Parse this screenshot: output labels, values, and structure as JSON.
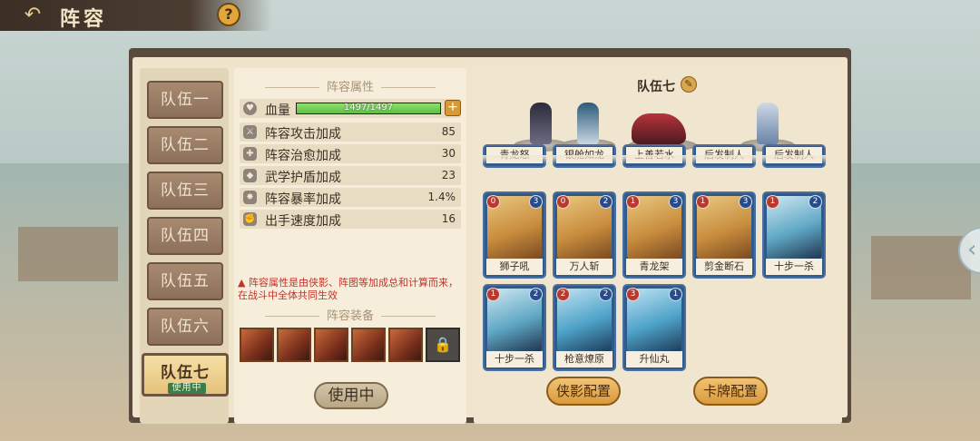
{
  "header": {
    "title": "阵容",
    "back_icon": "back-arrow-icon",
    "help_label": "?"
  },
  "side_arrow": "‹",
  "teams": [
    {
      "label": "队伍一"
    },
    {
      "label": "队伍二"
    },
    {
      "label": "队伍三"
    },
    {
      "label": "队伍四"
    },
    {
      "label": "队伍五"
    },
    {
      "label": "队伍六"
    },
    {
      "label": "队伍七",
      "badge": "使用中",
      "active": true
    }
  ],
  "attributes": {
    "section_title": "阵容属性",
    "hp": {
      "label": "血量",
      "text": "1497/1497",
      "fraction": 1.0
    },
    "hp_plus": "+",
    "rows": [
      {
        "label": "阵容攻击加成",
        "value": "85"
      },
      {
        "label": "阵容治愈加成",
        "value": "30"
      },
      {
        "label": "武学护盾加成",
        "value": "23"
      },
      {
        "label": "阵容暴率加成",
        "value": "1.4%"
      },
      {
        "label": "出手速度加成",
        "value": "16"
      }
    ],
    "note": "阵容属性是由侠影、阵图等加成总和计算而来，在战斗中全体共同生效"
  },
  "equipment": {
    "section_title": "阵容装备",
    "locked_icon": "lock-icon",
    "in_use_label": "使用中"
  },
  "lineup": {
    "team_name": "队伍七",
    "edit_icon": "quill-edit-icon",
    "top_row_cards": [
      "青龙怒",
      "银舱如龙",
      "上善若水",
      "后发制人",
      "后发制人"
    ],
    "cards": [
      {
        "name": "狮子吼",
        "cost": "0",
        "level": "3"
      },
      {
        "name": "万人斩",
        "cost": "0",
        "level": "2"
      },
      {
        "name": "青龙架",
        "cost": "1",
        "level": "3"
      },
      {
        "name": "剪金断石",
        "cost": "1",
        "level": "3"
      },
      {
        "name": "十步一杀",
        "cost": "1",
        "level": "2"
      },
      {
        "name": "十步一杀",
        "cost": "1",
        "level": "2"
      },
      {
        "name": "枪意燎原",
        "cost": "2",
        "level": "2"
      },
      {
        "name": "升仙丸",
        "cost": "3",
        "level": "1"
      }
    ],
    "hero_config_label": "侠影配置",
    "card_config_label": "卡牌配置"
  }
}
